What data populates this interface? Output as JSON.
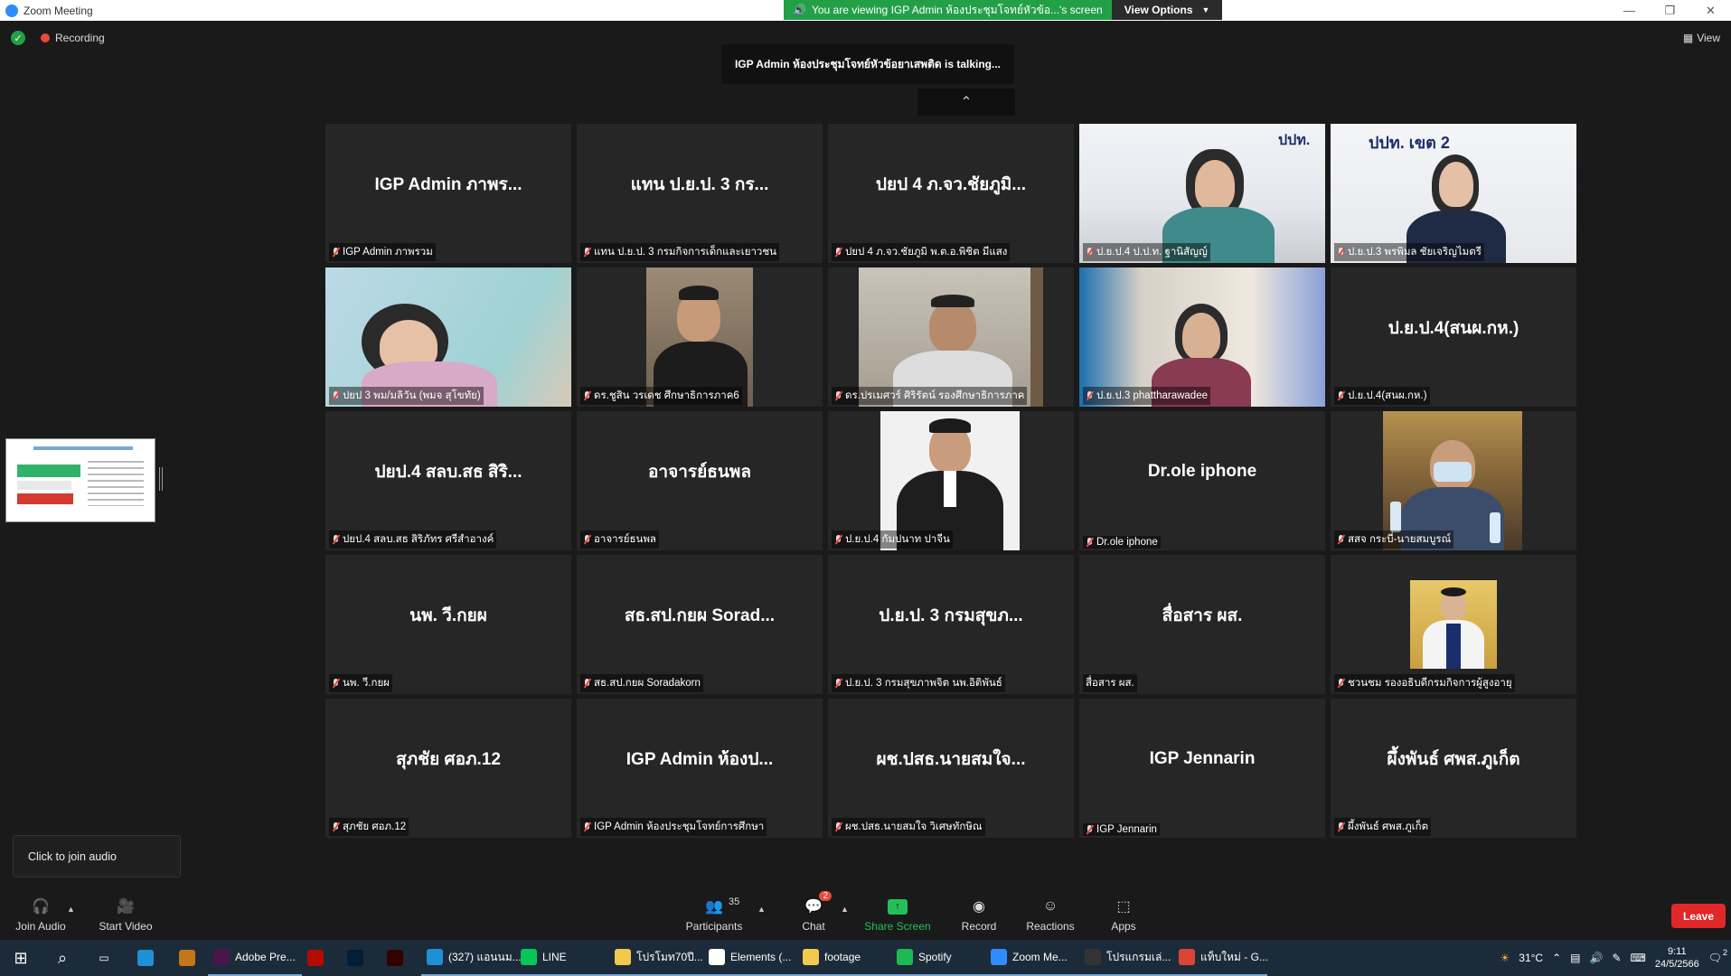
{
  "window": {
    "title": "Zoom Meeting",
    "controls": [
      "—",
      "❐",
      "✕"
    ]
  },
  "share_banner": {
    "text": "You are viewing IGP Admin ห้องประชุมโจทย์หัวข้อ...'s screen",
    "view_options": "View Options"
  },
  "top": {
    "recording": "Recording",
    "talking": "IGP Admin ห้องประชุมโจทย์หัวข้อยาเสพติด is talking...",
    "view": "View"
  },
  "tiles": [
    {
      "big": "IGP Admin ภาพร...",
      "name": "IGP Admin ภาพรวม",
      "muted": true
    },
    {
      "big": "แทน ป.ย.ป. 3 กร...",
      "name": "แทน ป.ย.ป. 3 กรมกิจการเด็กและเยาวชน",
      "muted": true
    },
    {
      "big": "ปยป 4 ภ.จว.ชัยภูมิ...",
      "name": "ปยป 4 ภ.จว.ชัยภูมิ พ.ต.อ.พิชิต มีแสง",
      "muted": true
    },
    {
      "big": "",
      "name": "ป.ย.ป.4 ป.ป.ท. ฐานิสัญญ์",
      "muted": true,
      "video": "woman-green"
    },
    {
      "big": "",
      "name": "ป.ย.ป.3 พรพิมล ชัยเจริญไมตรี",
      "muted": true,
      "video": "woman-banner"
    },
    {
      "big": "",
      "name": "ปยป 3 พม/มลิวัน (พมจ สุโขทัย)",
      "muted": true,
      "video": "woman-side"
    },
    {
      "big": "",
      "name": "ดร.ชูสิน วรเดช ศึกษาธิการภาค6",
      "muted": true,
      "video": "man-office"
    },
    {
      "big": "",
      "name": "ดร.ปรเมศวร์ ศิริรัตน์ รองศึกษาธิการภาค",
      "muted": true,
      "video": "man-glasses"
    },
    {
      "big": "",
      "name": "ป.ย.ป.3 phattharawadee",
      "muted": true,
      "video": "woman-room"
    },
    {
      "big": "ป.ย.ป.4(สนผ.กห.)",
      "name": "ป.ย.ป.4(สนผ.กห.)",
      "muted": true
    },
    {
      "big": "ปยป.4 สลบ.สธ สิริ...",
      "name": "ปยป.4 สลบ.สธ สิริภัทร ศรีสำอางค์",
      "muted": true
    },
    {
      "big": "อาจารย์ธนพล",
      "name": "อาจารย์ธนพล",
      "muted": true
    },
    {
      "big": "",
      "name": "ป.ย.ป.4 กัมปนาท ปาจีน",
      "muted": true,
      "video": "man-suit"
    },
    {
      "big": "Dr.ole iphone",
      "name": "Dr.ole iphone",
      "muted": true
    },
    {
      "big": "",
      "name": "สสจ กระบี่-นายสมบูรณ์",
      "muted": true,
      "video": "man-mask"
    },
    {
      "big": "นพ. วี.กยผ",
      "name": "นพ. วี.กยผ",
      "muted": true
    },
    {
      "big": "สธ.สป.กยผ Sorad...",
      "name": "สธ.สป.กยผ Soradakorn",
      "muted": true
    },
    {
      "big": "ป.ย.ป. 3 กรมสุขภ...",
      "name": "ป.ย.ป. 3 กรมสุขภาพจิต นพ.อิติพันธ์",
      "muted": true
    },
    {
      "big": "สื่อสาร ผส.",
      "name": "สื่อสาร ผส.",
      "muted": false
    },
    {
      "big": "",
      "name": "ชวนชม รองอธิบดีกรมกิจการผู้สูงอายุ",
      "muted": true,
      "video": "portrait"
    },
    {
      "big": "สุภชัย ศอภ.12",
      "name": "สุภชัย ศอภ.12",
      "muted": true
    },
    {
      "big": "IGP Admin ห้องป...",
      "name": "IGP Admin ห้องประชุมโจทย์การศึกษา",
      "muted": true
    },
    {
      "big": "ผช.ปสธ.นายสมใจ...",
      "name": "ผช.ปสธ.นายสมใจ วิเศษทักษิณ",
      "muted": true
    },
    {
      "big": "IGP Jennarin",
      "name": "IGP Jennarin",
      "muted": true
    },
    {
      "big": "ผึ้งพันธ์ ศพส.ภูเก็ต",
      "name": "ผึ้งพันธ์ ศพส.ภูเก็ต",
      "muted": true
    }
  ],
  "join_popup": "Click to join audio",
  "toolbar": {
    "join_audio": "Join Audio",
    "start_video": "Start Video",
    "participants": "Participants",
    "participants_count": "35",
    "chat": "Chat",
    "chat_badge": "2",
    "share_screen": "Share Screen",
    "record": "Record",
    "reactions": "Reactions",
    "apps": "Apps",
    "leave": "Leave"
  },
  "taskbar": {
    "apps": [
      {
        "label": "Adobe Pre...",
        "color": "#4a154b"
      },
      {
        "label": "",
        "color": "#b30b00"
      },
      {
        "label": "",
        "color": "#001e36"
      },
      {
        "label": "",
        "color": "#330000"
      },
      {
        "label": "(327) แอนนม...",
        "color": "#1f8fd6"
      },
      {
        "label": "LINE",
        "color": "#06c755"
      },
      {
        "label": "โปรโมท70ปี...",
        "color": "#f2c94c"
      },
      {
        "label": "Elements (...",
        "color": "#ffffff"
      },
      {
        "label": "footage",
        "color": "#f2c94c"
      },
      {
        "label": "Spotify",
        "color": "#1db954"
      },
      {
        "label": "Zoom Me...",
        "color": "#2d8cff"
      },
      {
        "label": "โปรแกรมเล่...",
        "color": "#333333"
      },
      {
        "label": "แท็บใหม่ - G...",
        "color": "#db4437"
      }
    ],
    "temp": "31°C",
    "time": "9:11",
    "date": "24/5/2566",
    "notif": "2"
  }
}
